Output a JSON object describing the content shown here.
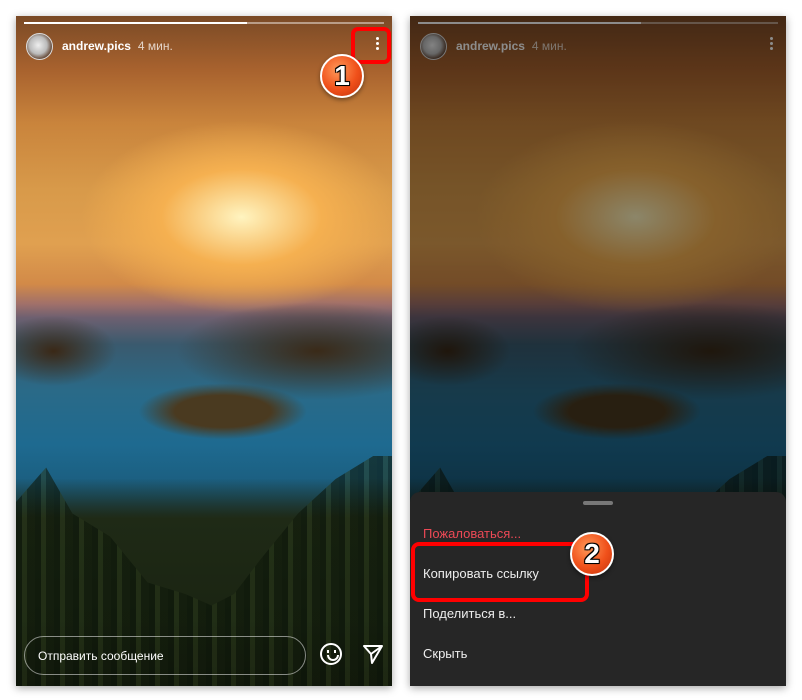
{
  "story": {
    "username": "andrew.pics",
    "time": "4 мин.",
    "progress": 0.62
  },
  "footer": {
    "message_placeholder": "Отправить сообщение"
  },
  "sheet": {
    "items": [
      {
        "label": "Пожаловаться...",
        "color": "#ed4956"
      },
      {
        "label": "Копировать ссылку"
      },
      {
        "label": "Поделиться в..."
      },
      {
        "label": "Скрыть"
      }
    ]
  },
  "annotations": {
    "step1": "1",
    "step2": "2",
    "highlight_color": "#ff0000"
  }
}
